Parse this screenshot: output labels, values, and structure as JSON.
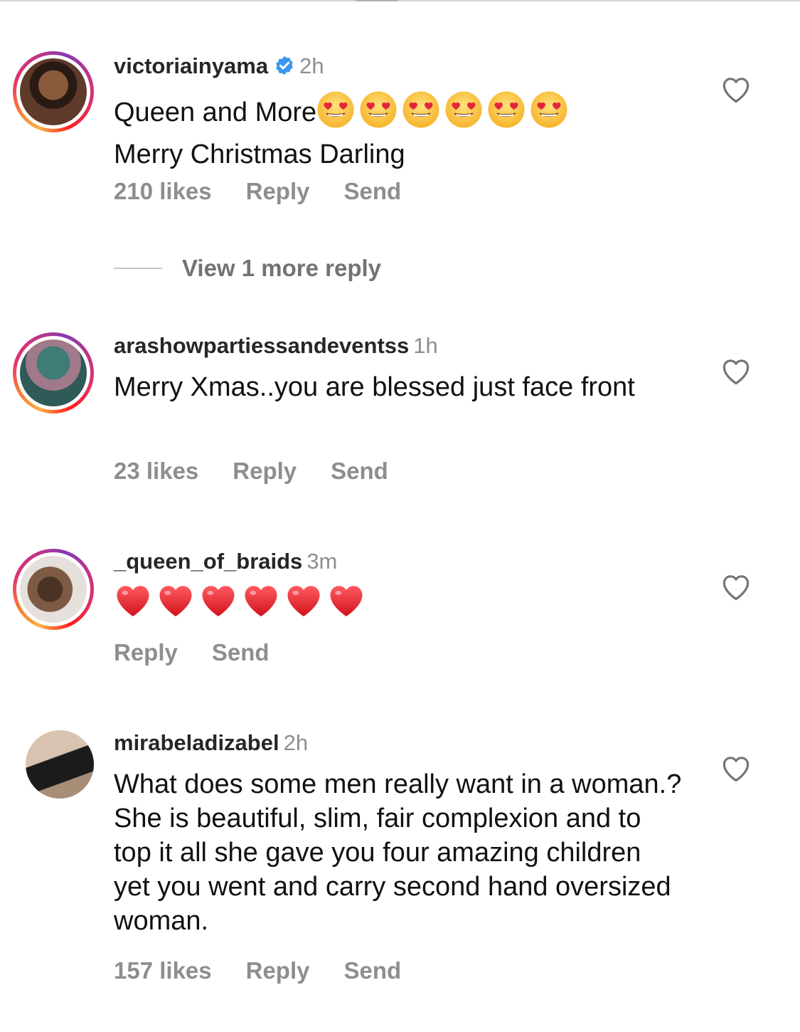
{
  "comments": [
    {
      "username": "victoriainyama",
      "verified": true,
      "time": "2h",
      "text_line1": "Queen and More",
      "emoji_icon": "heart-eyes-emoji",
      "emoji_count": 6,
      "text_line2": "Merry Christmas Darling",
      "likes": "210 likes",
      "reply": "Reply",
      "send": "Send"
    },
    {
      "username": "arashowpartiessandeventss",
      "verified": false,
      "time": "1h",
      "text": "Merry Xmas..you are blessed just face front",
      "likes": "23 likes",
      "reply": "Reply",
      "send": "Send"
    },
    {
      "username": "_queen_of_braids",
      "verified": false,
      "time": "3m",
      "emoji_icon": "red-heart-emoji",
      "emoji_count": 6,
      "reply": "Reply",
      "send": "Send"
    },
    {
      "username": "mirabeladizabel",
      "verified": false,
      "time": "2h",
      "text": "What does some men really want in a woman.? She is beautiful, slim, fair complexion and to top it all she gave you four amazing children yet you went and carry second hand oversized woman.",
      "likes": "157 likes",
      "reply": "Reply",
      "send": "Send"
    }
  ],
  "view_more_replies": "View 1 more reply",
  "colors": {
    "secondary_text": "#8e8e8e",
    "verified_blue": "#3897f0",
    "story_ring": [
      "#fcaf45",
      "#e1306c",
      "#833ab4"
    ]
  },
  "icons": {
    "like": "heart-outline-icon",
    "verified": "verified-badge-icon"
  }
}
